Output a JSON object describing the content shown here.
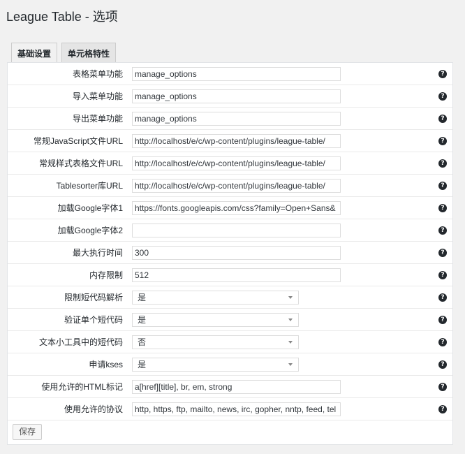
{
  "page": {
    "title": "League Table - 选项"
  },
  "tabs": [
    {
      "label": "基础设置"
    },
    {
      "label": "单元格特性"
    }
  ],
  "fields": [
    {
      "label": "表格菜单功能",
      "type": "text",
      "value": "manage_options"
    },
    {
      "label": "导入菜单功能",
      "type": "text",
      "value": "manage_options"
    },
    {
      "label": "导出菜单功能",
      "type": "text",
      "value": "manage_options"
    },
    {
      "label": "常规JavaScript文件URL",
      "type": "text",
      "value": "http://localhost/e/c/wp-content/plugins/league-table/"
    },
    {
      "label": "常规样式表格文件URL",
      "type": "text",
      "value": "http://localhost/e/c/wp-content/plugins/league-table/"
    },
    {
      "label": "Tablesorter库URL",
      "type": "text",
      "value": "http://localhost/e/c/wp-content/plugins/league-table/"
    },
    {
      "label": "加载Google字体1",
      "type": "text",
      "value": "https://fonts.googleapis.com/css?family=Open+Sans&"
    },
    {
      "label": "加载Google字体2",
      "type": "text",
      "value": ""
    },
    {
      "label": "最大执行时间",
      "type": "text",
      "value": "300"
    },
    {
      "label": "内存限制",
      "type": "text",
      "value": "512"
    },
    {
      "label": "限制短代码解析",
      "type": "select",
      "value": "是"
    },
    {
      "label": "验证单个短代码",
      "type": "select",
      "value": "是"
    },
    {
      "label": "文本小工具中的短代码",
      "type": "select",
      "value": "否"
    },
    {
      "label": "申请kses",
      "type": "select",
      "value": "是"
    },
    {
      "label": "使用允许的HTML标记",
      "type": "text",
      "value": "a[href][title], br, em, strong"
    },
    {
      "label": "使用允许的协议",
      "type": "text",
      "value": "http, https, ftp, mailto, news, irc, gopher, nntp, feed, tel"
    }
  ],
  "help_icon_glyph": "?",
  "save_label": "保存"
}
